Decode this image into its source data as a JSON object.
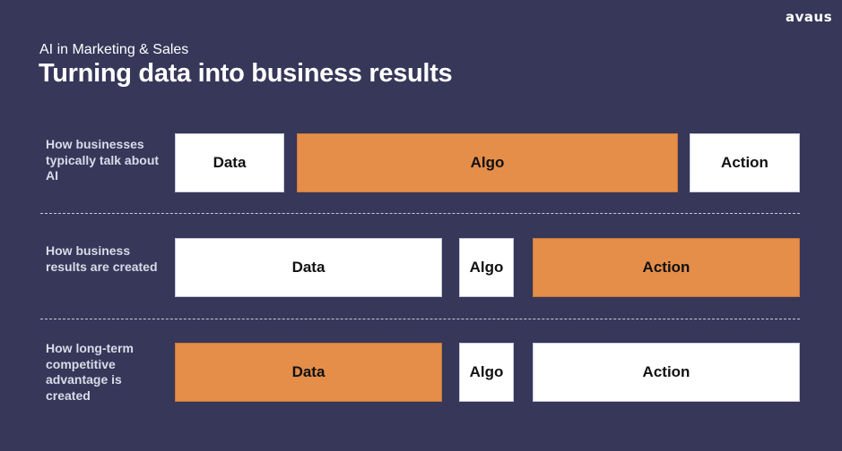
{
  "brand": {
    "logo_text": "avaus"
  },
  "header": {
    "subtitle": "AI in Marketing & Sales",
    "title": "Turning data into business results"
  },
  "colors": {
    "background": "#363759",
    "highlight": "#e48e4a",
    "box": "#ffffff"
  },
  "rows": [
    {
      "label": "How businesses typically talk about AI",
      "boxes": [
        {
          "label": "Data",
          "highlighted": false
        },
        {
          "label": "Algo",
          "highlighted": true
        },
        {
          "label": "Action",
          "highlighted": false
        }
      ]
    },
    {
      "label": "How business results are created",
      "boxes": [
        {
          "label": "Data",
          "highlighted": false
        },
        {
          "label": "Algo",
          "highlighted": false
        },
        {
          "label": "Action",
          "highlighted": true
        }
      ]
    },
    {
      "label": "How long-term competitive advantage is created",
      "boxes": [
        {
          "label": "Data",
          "highlighted": true
        },
        {
          "label": "Algo",
          "highlighted": false
        },
        {
          "label": "Action",
          "highlighted": false
        }
      ]
    }
  ]
}
